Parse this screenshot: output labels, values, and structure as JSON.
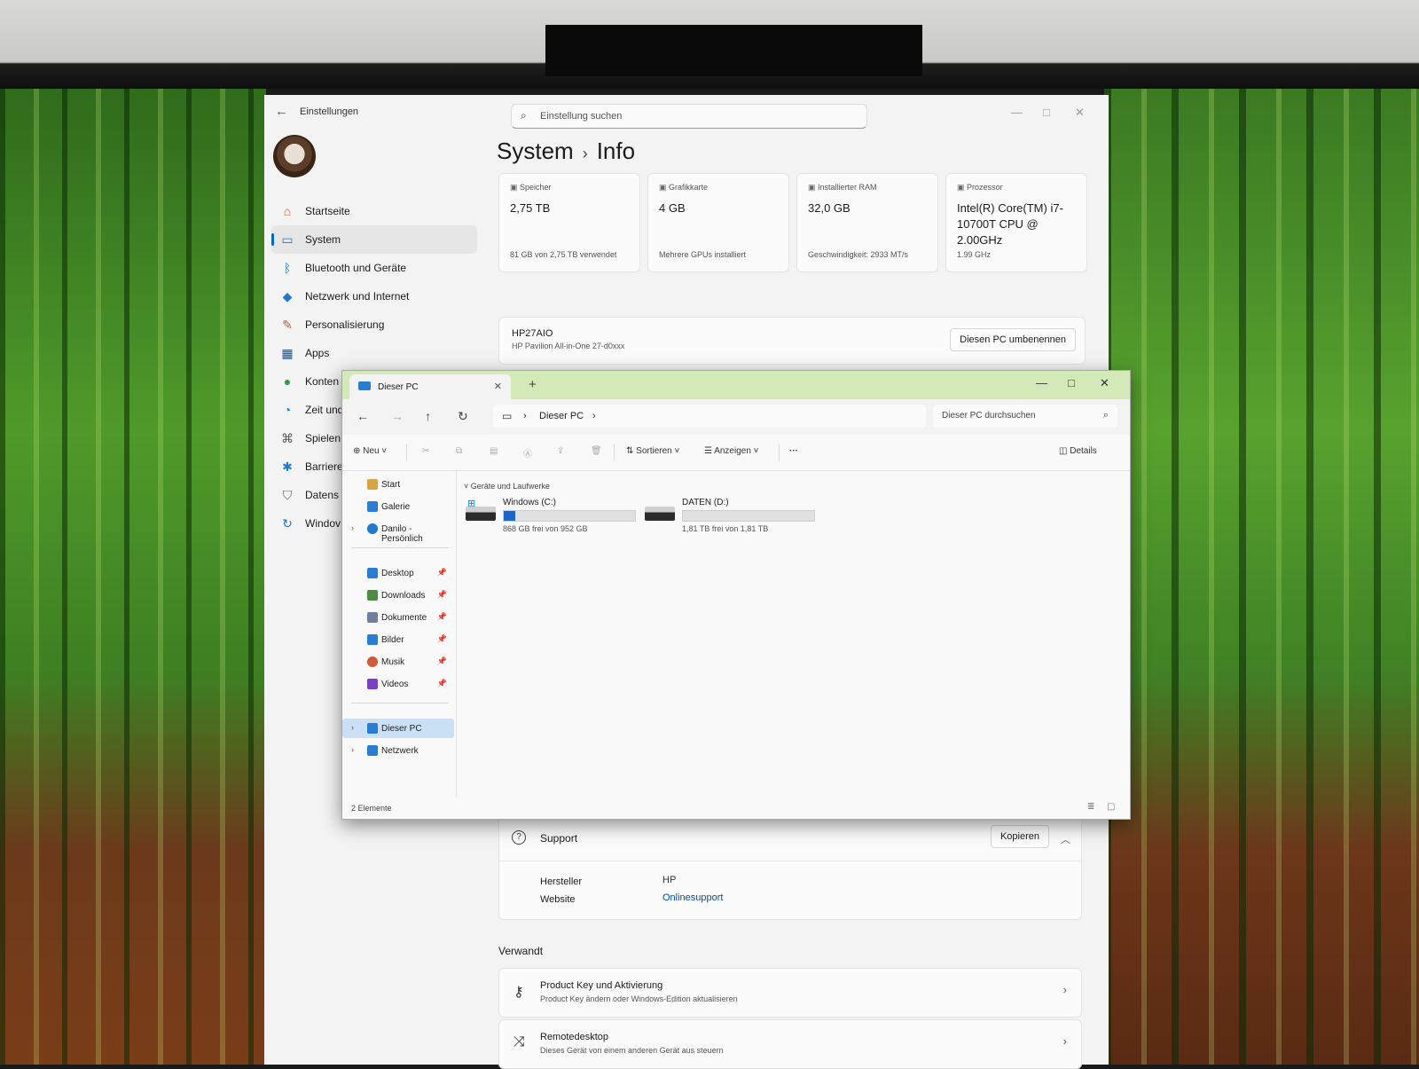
{
  "settings": {
    "app_title": "Einstellungen",
    "search_placeholder": "Einstellung suchen",
    "heading_parent": "System",
    "heading_sep": "›",
    "heading_child": "Info",
    "nav": [
      {
        "label": "Startseite",
        "icon": "home-icon"
      },
      {
        "label": "System",
        "icon": "monitor-icon",
        "active": true
      },
      {
        "label": "Bluetooth und Geräte",
        "icon": "bluetooth-icon"
      },
      {
        "label": "Netzwerk und Internet",
        "icon": "wifi-icon"
      },
      {
        "label": "Personalisierung",
        "icon": "brush-icon"
      },
      {
        "label": "Apps",
        "icon": "apps-icon"
      },
      {
        "label": "Konten",
        "icon": "person-icon"
      },
      {
        "label": "Zeit und",
        "icon": "clock-icon"
      },
      {
        "label": "Spielen",
        "icon": "gamepad-icon"
      },
      {
        "label": "Barriere",
        "icon": "accessibility-icon"
      },
      {
        "label": "Datens",
        "icon": "shield-icon"
      },
      {
        "label": "Windov",
        "icon": "update-icon"
      }
    ],
    "specs": [
      {
        "label": "Speicher",
        "value": "2,75 TB",
        "sub": "81 GB von 2,75 TB verwendet"
      },
      {
        "label": "Grafikkarte",
        "value": "4 GB",
        "sub": "Mehrere GPUs installiert"
      },
      {
        "label": "Installierter RAM",
        "value": "32,0 GB",
        "sub": "Geschwindigkeit: 2933 MT/s"
      },
      {
        "label": "Prozessor",
        "value": "Intel(R) Core(TM) i7-10700T CPU @ 2.00GHz",
        "sub": "1.99 GHz"
      }
    ],
    "pc_name": "HP27AIO",
    "pc_model": "HP Pavilion All-in-One 27-d0xxx",
    "rename_button": "Diesen PC umbenennen",
    "support": {
      "title": "Support",
      "copy_button": "Kopieren",
      "manufacturer_key": "Hersteller",
      "manufacturer_val": "HP",
      "website_key": "Website",
      "website_val": "Onlinesupport"
    },
    "related_title": "Verwandt",
    "related": [
      {
        "title": "Product Key und Aktivierung",
        "sub": "Product Key ändern oder Windows-Edition aktualisieren",
        "icon": "key-icon"
      },
      {
        "title": "Remotedesktop",
        "sub": "Dieses Gerät von einem anderen Gerät aus steuern",
        "icon": "remote-icon"
      }
    ]
  },
  "explorer": {
    "tab_label": "Dieser PC",
    "breadcrumb": "Dieser PC",
    "search_placeholder": "Dieser PC durchsuchen",
    "toolbar": {
      "new": "Neu",
      "sort": "Sortieren",
      "view": "Anzeigen",
      "more": "···",
      "details": "Details"
    },
    "sidebar": [
      {
        "label": "Start",
        "color": "#d9a441"
      },
      {
        "label": "Galerie",
        "color": "#2b7cd3"
      },
      {
        "label": "Danilo - Persönlich",
        "color": "#1f78d1",
        "expandable": true
      },
      {
        "label": "Desktop",
        "color": "#2b7cd3",
        "pinned": true
      },
      {
        "label": "Downloads",
        "color": "#4a8f3f",
        "pinned": true
      },
      {
        "label": "Dokumente",
        "color": "#6e7fa0",
        "pinned": true
      },
      {
        "label": "Bilder",
        "color": "#2b7cd3",
        "pinned": true
      },
      {
        "label": "Musik",
        "color": "#d2583a",
        "pinned": true
      },
      {
        "label": "Videos",
        "color": "#7a3fc2",
        "pinned": true
      },
      {
        "label": "Dieser PC",
        "color": "#2b7cd3",
        "expandable": true,
        "selected": true
      },
      {
        "label": "Netzwerk",
        "color": "#2b7cd3",
        "expandable": true
      }
    ],
    "group_label": "Geräte und Laufwerke",
    "drives": [
      {
        "name": "Windows (C:)",
        "free": "868 GB frei von 952 GB",
        "used_fraction": 0.09
      },
      {
        "name": "DATEN (D:)",
        "free": "1,81 TB frei von 1,81 TB",
        "used_fraction": 0.0
      }
    ],
    "status": "2 Elemente"
  }
}
